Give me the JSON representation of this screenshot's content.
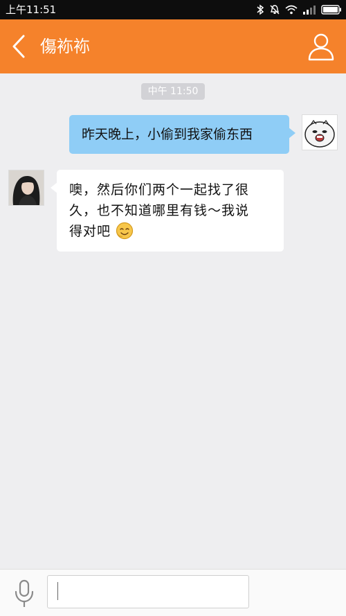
{
  "status_bar": {
    "time": "上午11:51",
    "icons": [
      "bluetooth-icon",
      "alarm-off-icon",
      "wifi-icon",
      "signal-icon",
      "battery-icon"
    ]
  },
  "header": {
    "title": "傷袮袮",
    "back_icon": "chevron-left-icon",
    "profile_icon": "person-outline-icon",
    "background_color": "#f5822b"
  },
  "chat": {
    "timestamp": "中午 11:50",
    "messages": [
      {
        "direction": "sent",
        "text": "昨天晚上，小偷到我家偷东西",
        "bubble_color": "#8fcdf6"
      },
      {
        "direction": "received",
        "lines": [
          "噢，然后你们两个一起找了很",
          "久，也不知道哪里有钱～我说",
          "得对吧"
        ],
        "emoji": "smiling-face-emoji",
        "bubble_color": "#ffffff"
      }
    ]
  },
  "input_bar": {
    "mic_icon": "microphone-icon",
    "value": "",
    "placeholder": ""
  }
}
